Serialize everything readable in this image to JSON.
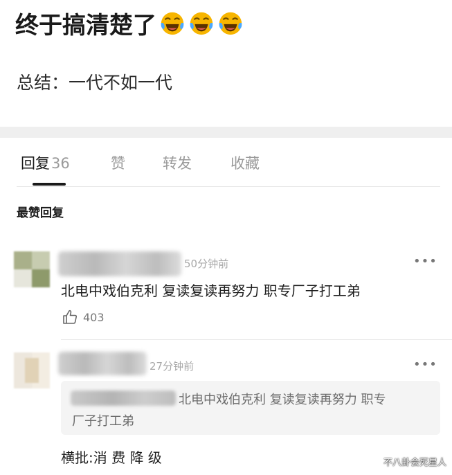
{
  "post": {
    "title": "终于搞清楚了",
    "emoji_icons": [
      "laughing-tears-icon",
      "laughing-tears-icon",
      "laughing-tears-icon"
    ],
    "summary": "总结：一代不如一代"
  },
  "tabs": [
    {
      "label": "回复",
      "count": "36",
      "active": true
    },
    {
      "label": "赞",
      "active": false
    },
    {
      "label": "转发",
      "active": false
    },
    {
      "label": "收藏",
      "active": false
    }
  ],
  "top_replies_heading": "最赞回复",
  "comments": [
    {
      "time": "50分钟前",
      "text": "北电中戏伯克利 复读复读再努力 职专厂子打工弟",
      "likes": "403",
      "more_icon": "more-dots-icon"
    },
    {
      "time": "27分钟前",
      "quote_line1": "北电中戏伯克利 复读复读再努力 职专",
      "quote_line2": "厂子打工弟",
      "text": "横批:消 费 降 级",
      "more_icon": "more-dots-icon"
    }
  ],
  "watermark": "不八卦会死星人",
  "colors": {
    "background": "#ffffff",
    "section_gap": "#efefef",
    "quote_bg": "#f4f4f4",
    "emoji_yellow": "#f7b500"
  }
}
